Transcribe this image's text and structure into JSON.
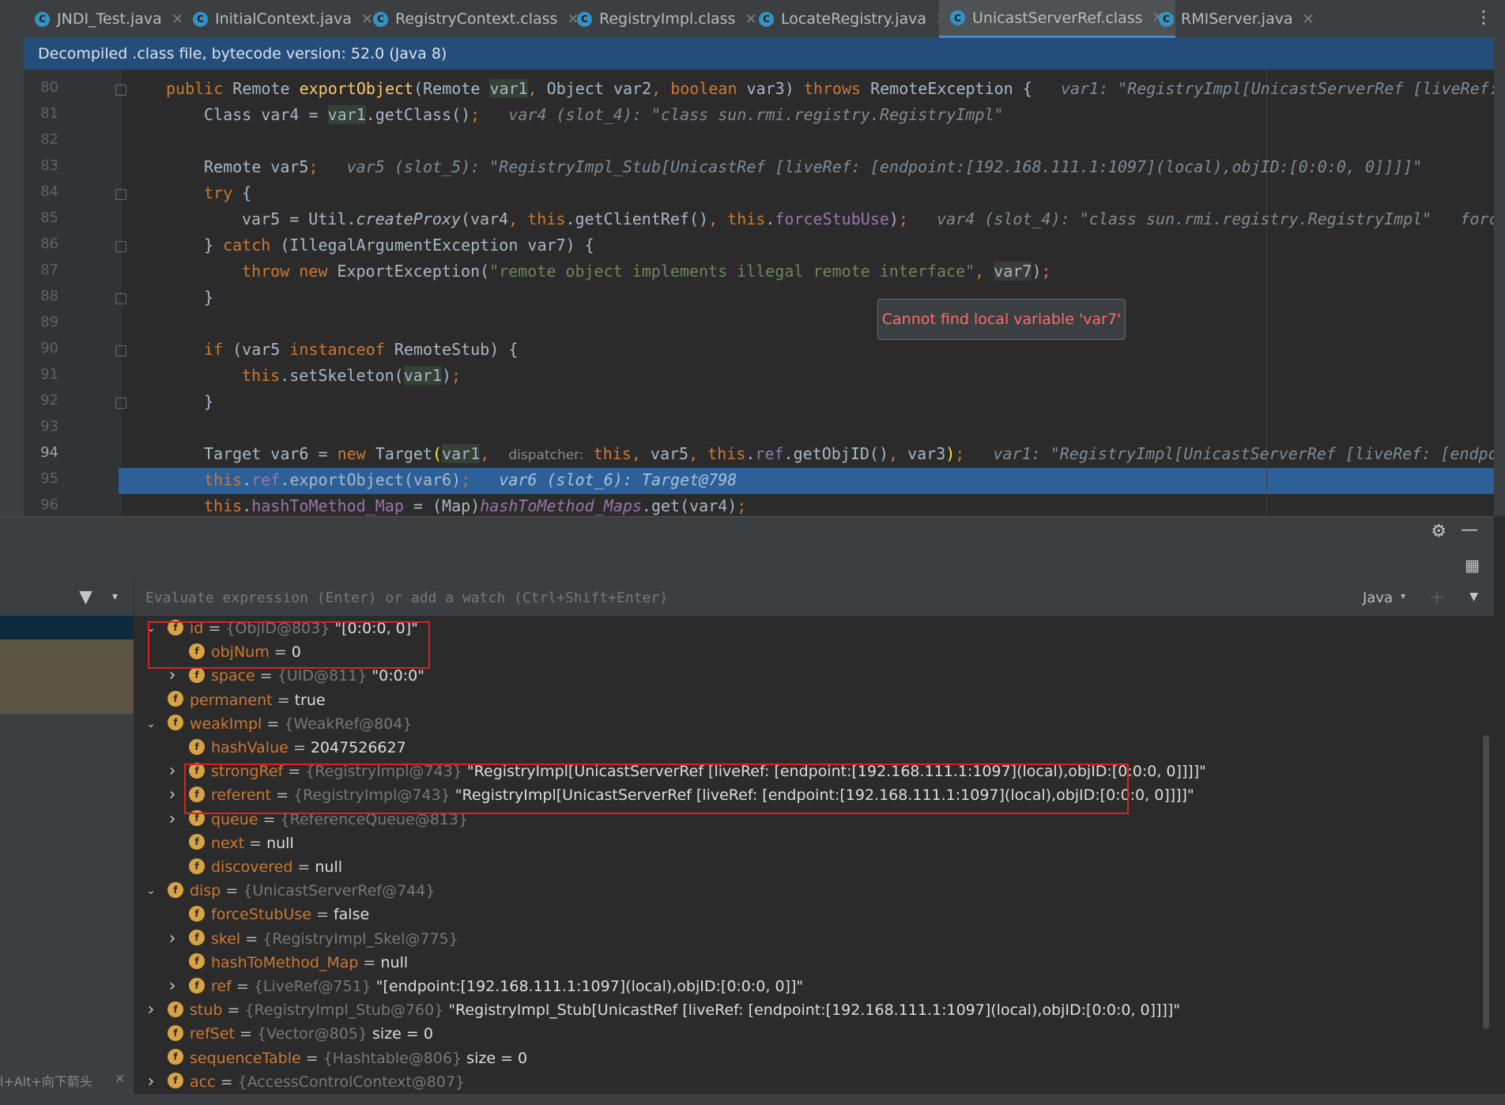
{
  "tabs": [
    {
      "label": "JNDI_Test.java",
      "icon": "c-class-icon",
      "active": false
    },
    {
      "label": "InitialContext.java",
      "icon": "c-class-icon",
      "active": false
    },
    {
      "label": "RegistryContext.class",
      "icon": "c-class-icon",
      "active": false
    },
    {
      "label": "RegistryImpl.class",
      "icon": "c-class-icon",
      "active": false
    },
    {
      "label": "LocateRegistry.java",
      "icon": "c-class-icon",
      "active": false
    },
    {
      "label": "UnicastServerRef.class",
      "icon": "c-class-icon",
      "active": true
    },
    {
      "label": "RMIServer.java",
      "icon": "c-class-icon",
      "active": false
    }
  ],
  "banner": "Decompiled .class file, bytecode version: 52.0 (Java 8)",
  "editor": {
    "line_numbers": [
      "80",
      "81",
      "82",
      "83",
      "84",
      "85",
      "86",
      "87",
      "88",
      "89",
      "90",
      "91",
      "92",
      "93",
      "94",
      "95",
      "96"
    ],
    "l80_hint": "var1: \"RegistryImpl[UnicastServerRef [liveRef:",
    "l81_hint": "var4 (slot_4): \"class sun.rmi.registry.RegistryImpl\"",
    "l83_hint": "var5 (slot_5): \"RegistryImpl_Stub[UnicastRef [liveRef: [endpoint:[192.168.111.1:1097](local),objID:[0:0:0, 0]]]]\"",
    "l85_hint": "var4 (slot_4): \"class sun.rmi.registry.RegistryImpl\"",
    "l85_hint2": "forc",
    "l87_string": "\"remote object implements illegal remote interface\"",
    "l94_param_hint": "dispatcher:",
    "l94_hint": "var1: \"RegistryImpl[UnicastServerRef [liveRef: [endpoi",
    "l95_hint": "var6 (slot_6): Target@798",
    "tooltip": "Cannot find local variable 'var7'"
  },
  "debugger": {
    "eval_placeholder": "Evaluate expression (Enter) or add a watch (Ctrl+Shift+Enter)",
    "language": "Java",
    "left_hint": "l+Alt+向下箭头",
    "nodes": [
      {
        "arrow": "expanded",
        "name": "id",
        "eq": " = ",
        "type": "{ObjID@803}",
        "value": " \"[0:0:0, 0]\""
      },
      {
        "arrow": "none",
        "name": "objNum",
        "eq": " = ",
        "type": "",
        "value": "0"
      },
      {
        "arrow": "collapsed",
        "name": "space",
        "eq": " = ",
        "type": "{UID@811}",
        "value": " \"0:0:0\""
      },
      {
        "arrow": "none",
        "name": "permanent",
        "eq": " = ",
        "type": "",
        "value": "true"
      },
      {
        "arrow": "expanded",
        "name": "weakImpl",
        "eq": " = ",
        "type": "{WeakRef@804}",
        "value": ""
      },
      {
        "arrow": "none",
        "name": "hashValue",
        "eq": " = ",
        "type": "",
        "value": "2047526627"
      },
      {
        "arrow": "collapsed",
        "name": "strongRef",
        "eq": " = ",
        "type": "{RegistryImpl@743}",
        "value": " \"RegistryImpl[UnicastServerRef [liveRef: [endpoint:[192.168.111.1:1097](local),objID:[0:0:0, 0]]]]\""
      },
      {
        "arrow": "collapsed",
        "name": "referent",
        "eq": " = ",
        "type": "{RegistryImpl@743}",
        "value": " \"RegistryImpl[UnicastServerRef [liveRef: [endpoint:[192.168.111.1:1097](local),objID:[0:0:0, 0]]]]\""
      },
      {
        "arrow": "collapsed",
        "name": "queue",
        "eq": " = ",
        "type": "{ReferenceQueue@813}",
        "value": ""
      },
      {
        "arrow": "none",
        "name": "next",
        "eq": " = ",
        "type": "",
        "value": "null"
      },
      {
        "arrow": "none",
        "name": "discovered",
        "eq": " = ",
        "type": "",
        "value": "null"
      },
      {
        "arrow": "expanded",
        "name": "disp",
        "eq": " = ",
        "type": "{UnicastServerRef@744}",
        "value": ""
      },
      {
        "arrow": "none",
        "name": "forceStubUse",
        "eq": " = ",
        "type": "",
        "value": "false"
      },
      {
        "arrow": "collapsed",
        "name": "skel",
        "eq": " = ",
        "type": "{RegistryImpl_Skel@775}",
        "value": ""
      },
      {
        "arrow": "none",
        "name": "hashToMethod_Map",
        "eq": " = ",
        "type": "",
        "value": "null"
      },
      {
        "arrow": "collapsed",
        "name": "ref",
        "eq": " = ",
        "type": "{LiveRef@751}",
        "value": " \"[endpoint:[192.168.111.1:1097](local),objID:[0:0:0, 0]]\""
      },
      {
        "arrow": "collapsed",
        "name": "stub",
        "eq": " = ",
        "type": "{RegistryImpl_Stub@760}",
        "value": " \"RegistryImpl_Stub[UnicastRef [liveRef: [endpoint:[192.168.111.1:1097](local),objID:[0:0:0, 0]]]]\""
      },
      {
        "arrow": "none",
        "name": "refSet",
        "eq": " = ",
        "type": "{Vector@805}",
        "value": "  size = 0"
      },
      {
        "arrow": "none",
        "name": "sequenceTable",
        "eq": " = ",
        "type": "{Hashtable@806}",
        "value": "  size = 0"
      },
      {
        "arrow": "collapsed",
        "name": "acc",
        "eq": " = ",
        "type": "{AccessControlContext@807}",
        "value": ""
      }
    ]
  },
  "colors": {
    "accent": "#2d6099",
    "highlight_box": "#e02020",
    "field_icon": "#d9a343"
  }
}
